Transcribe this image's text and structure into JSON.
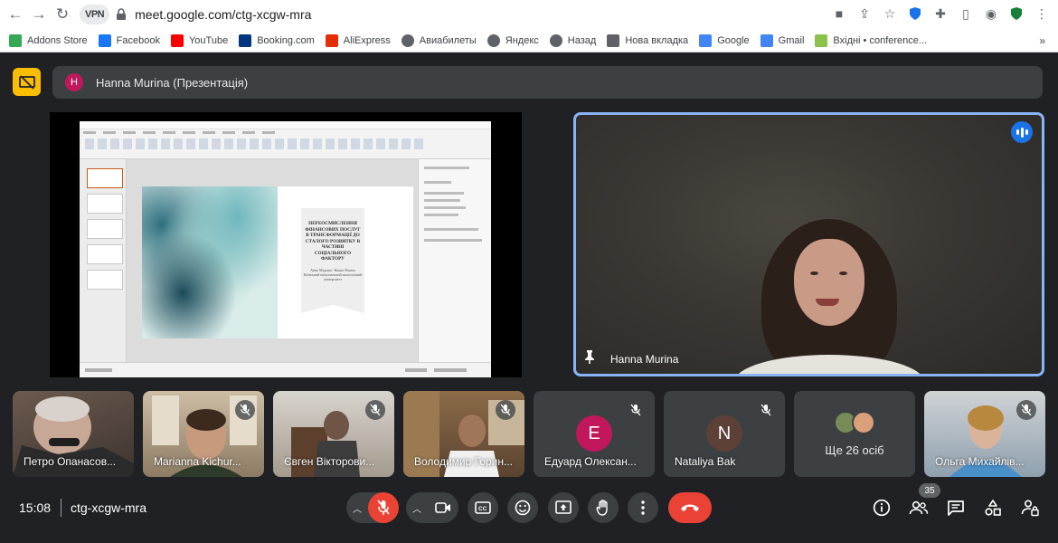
{
  "browser": {
    "vpn_label": "VPN",
    "url": "meet.google.com/ctg-xcgw-mra",
    "bookmarks": [
      {
        "label": "Addons Store",
        "icon": "addons-icon",
        "color": "#34a853"
      },
      {
        "label": "Facebook",
        "icon": "facebook-icon",
        "color": "#1877f2"
      },
      {
        "label": "YouTube",
        "icon": "youtube-icon",
        "color": "#ff0000"
      },
      {
        "label": "Booking.com",
        "icon": "booking-icon",
        "color": "#003580"
      },
      {
        "label": "AliExpress",
        "icon": "aliexpress-icon",
        "color": "#e62e04"
      },
      {
        "label": "Авиабилеты",
        "icon": "globe-icon",
        "color": "#5f6368"
      },
      {
        "label": "Яндекс",
        "icon": "globe-icon",
        "color": "#5f6368"
      },
      {
        "label": "Назад",
        "icon": "globe-icon",
        "color": "#5f6368"
      },
      {
        "label": "Нова вкладка",
        "icon": "page-icon",
        "color": "#5f6368"
      },
      {
        "label": "Google",
        "icon": "google-icon",
        "color": "#4285f4"
      },
      {
        "label": "Gmail",
        "icon": "google-icon",
        "color": "#4285f4"
      },
      {
        "label": "Вхідні • conference...",
        "icon": "inbox-icon",
        "color": "#8bc34a"
      }
    ],
    "more": "»"
  },
  "meet": {
    "presenter_initial": "H",
    "presenter_label": "Hanna Murina (Презентація)",
    "slide": {
      "title": "ПЕРЕОСМИСЛЕННЯ ФІНАНСОВИХ ПОСЛУГ В ТРАНСФОРМАЦІЇ ДО СТАЛОГО РОЗВИТКУ В ЧАСТИНІ СОЦІАЛЬНОГО ФАКТОРУ",
      "subtitle": "Анна Мурина / Hanna Murina Київський національний економічний університет"
    },
    "speaker_name": "Hanna Murina",
    "tiles": [
      {
        "name": "Петро Опанасов..."
      },
      {
        "name": "Marianna Kichur..."
      },
      {
        "name": "Євген Вікторови..."
      },
      {
        "name": "Володимир Горин..."
      },
      {
        "name": "Едуард Олексан...",
        "initial": "E",
        "color": "#c2185b"
      },
      {
        "name": "Nataliya Bak",
        "initial": "N",
        "color": "#5d4037"
      },
      {
        "more_label": "Ще 26 осіб"
      },
      {
        "name": "Ольга Михайлів..."
      }
    ],
    "time": "15:08",
    "meeting_code": "ctg-xcgw-mra",
    "participant_count": "35"
  }
}
